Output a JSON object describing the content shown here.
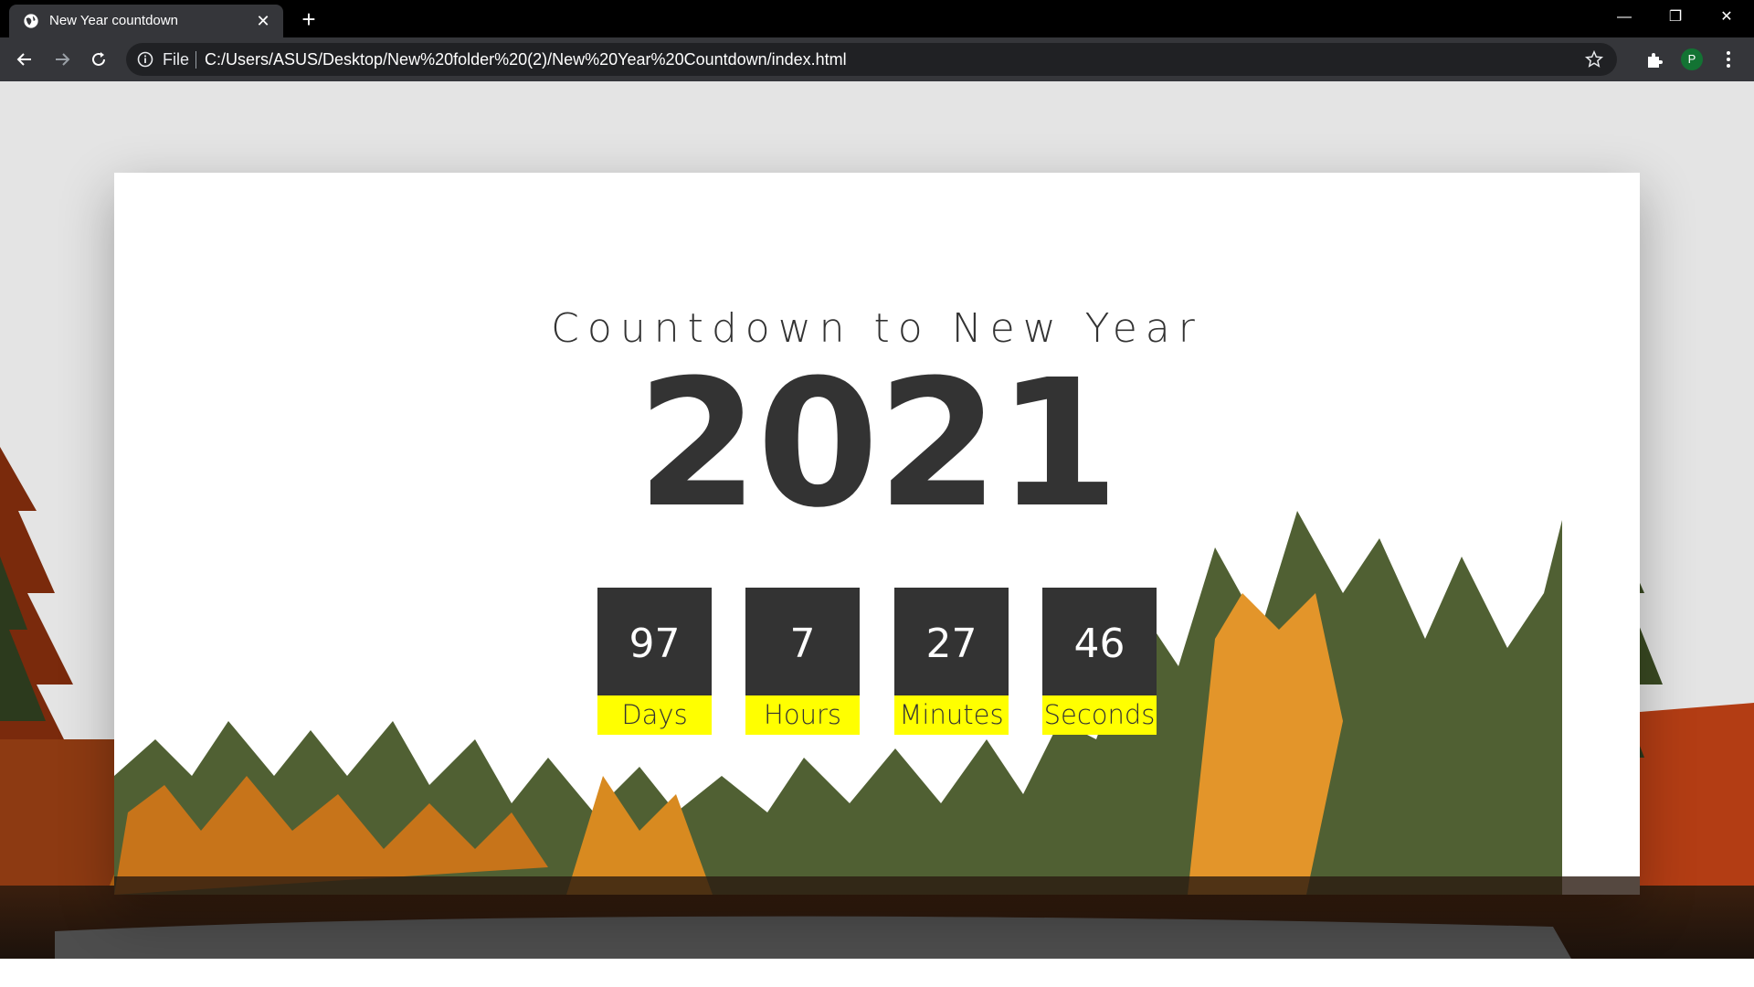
{
  "browser": {
    "tab_title": "New Year countdown",
    "close_tab_glyph": "✕",
    "new_tab_glyph": "+",
    "window_controls": {
      "minimize": "—",
      "restore": "❐",
      "close": "✕"
    },
    "scheme_label": "File",
    "url": "C:/Users/ASUS/Desktop/New%20folder%20(2)/New%20Year%20Countdown/index.html",
    "profile_initial": "P",
    "icons": [
      "globe-icon",
      "back-arrow-icon",
      "forward-arrow-icon",
      "reload-icon",
      "info-icon",
      "star-icon",
      "extensions-icon",
      "kebab-menu-icon"
    ]
  },
  "page": {
    "heading": "Countdown to New Year",
    "year": "2021",
    "countdown": [
      {
        "value": "97",
        "label": "Days"
      },
      {
        "value": "7",
        "label": "Hours"
      },
      {
        "value": "27",
        "label": "Minutes"
      },
      {
        "value": "46",
        "label": "Seconds"
      }
    ],
    "colors": {
      "text_dark": "#333333",
      "label_bg": "#ffff00",
      "card_bg": "#ffffff",
      "page_bg": "#e4e4e4"
    },
    "background_image": "autumn-forest-and-mountain-scene"
  }
}
